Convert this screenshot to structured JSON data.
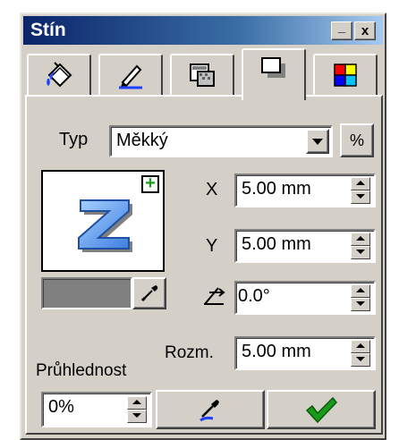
{
  "window": {
    "title": "Stín"
  },
  "titlebar_buttons": {
    "minimize": "_",
    "close": "x"
  },
  "tabs": [
    {
      "icon": "paint-bucket-icon",
      "active": false
    },
    {
      "icon": "pen-icon",
      "active": false
    },
    {
      "icon": "transparency-icon",
      "active": false
    },
    {
      "icon": "shadow-icon",
      "active": true
    },
    {
      "icon": "color-palette-icon",
      "active": false
    }
  ],
  "type": {
    "label": "Typ",
    "value": "Měkký",
    "percent_button": "%"
  },
  "preview": {
    "letter": "Z",
    "plus": "+"
  },
  "shadow_color": "#808080",
  "x": {
    "label": "X",
    "value": "5.00 mm"
  },
  "y": {
    "label": "Y",
    "value": "5.00 mm"
  },
  "angle": {
    "value": "0.0°"
  },
  "size": {
    "label": "Rozm.",
    "value": "5.00 mm"
  },
  "opacity": {
    "label": "Průhlednost",
    "value": "0%"
  },
  "colors": {
    "accent_blue": "#0a246a",
    "check_green": "#1a9a1a",
    "panel": "#d4d0c8"
  }
}
